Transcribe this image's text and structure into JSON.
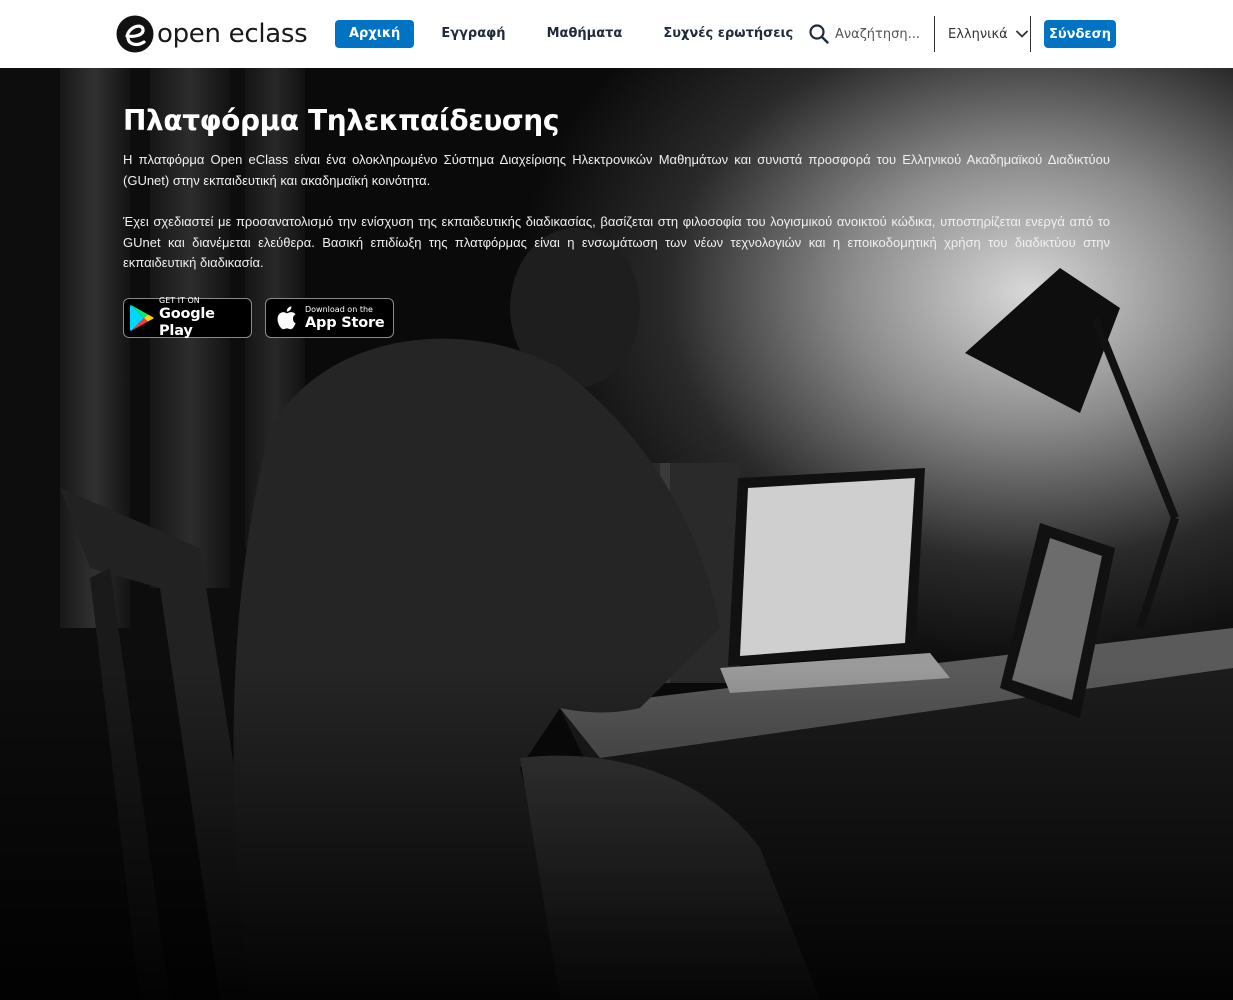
{
  "header": {
    "logo_text": "open eclass",
    "nav": [
      {
        "label": "Αρχική"
      },
      {
        "label": "Εγγραφή"
      },
      {
        "label": "Μαθήματα"
      },
      {
        "label": "Συχνές ερωτήσεις"
      }
    ],
    "search": {
      "placeholder": "Αναζήτηση..."
    },
    "language": {
      "selected": "Ελληνικά"
    },
    "login_label": "Σύνδεση"
  },
  "hero": {
    "title": "Πλατφόρμα Τηλεκπαίδευσης",
    "paragraphs": [
      "Η πλατφόρμα Open eClass είναι ένα ολοκληρωμένο Σύστημα Διαχείρισης Ηλεκτρονικών Μαθημάτων και συνιστά προσφορά του Ελληνικού Ακαδημαϊκού Διαδικτύου (GUnet) στην εκπαιδευτική και ακαδημαϊκή κοινότητα.",
      "Έχει σχεδιαστεί με προσανατολισμό την ενίσχυση της εκπαιδευτικής διαδικασίας, βασίζεται στη φιλοσοφία του λογισμικού ανοικτού κώδικα, υποστηρίζεται ενεργά από το GUnet και διανέμεται ελεύθερα. Βασική επιδίωξη της πλατφόρμας είναι η ενσωμάτωση των νέων τεχνολογιών και η εποικοδομητική χρήση του διαδικτύου στην εκπαιδευτική διαδικασία."
    ],
    "stores": [
      {
        "small": "GET IT ON",
        "large": "Google Play",
        "icon": "google-play-icon"
      },
      {
        "small": "Download on the",
        "large": "App Store",
        "icon": "apple-icon"
      }
    ]
  },
  "colors": {
    "accent": "#0073c4",
    "header_bg": "#ffffff",
    "hero_text": "#ffffff"
  }
}
